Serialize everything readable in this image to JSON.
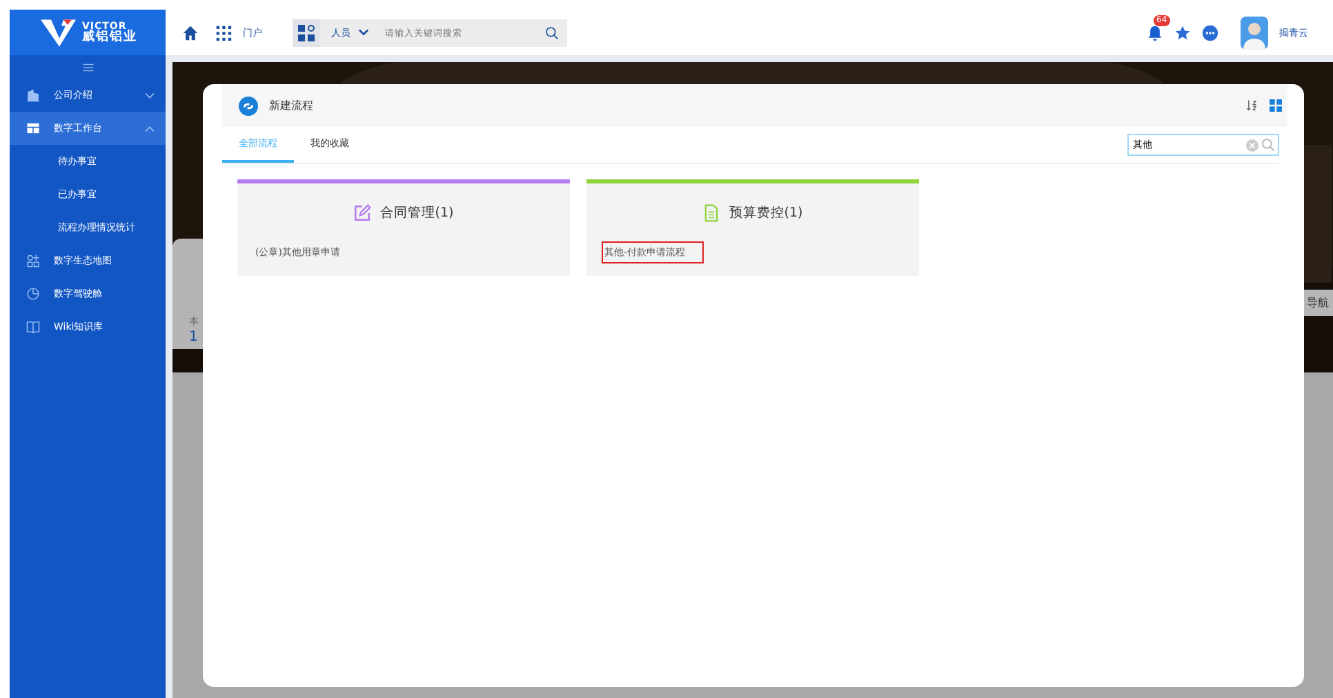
{
  "sidebar": {
    "logo": {
      "wordmark": "VICTOR",
      "name": "威铝铝业"
    },
    "items": [
      {
        "label": "公司介绍",
        "selected": false,
        "expanded": false
      },
      {
        "label": "数字工作台",
        "selected": true,
        "expanded": true,
        "children": [
          {
            "label": "待办事宜"
          },
          {
            "label": "已办事宜"
          },
          {
            "label": "流程办理情况统计"
          }
        ]
      },
      {
        "label": "数字生态地图",
        "selected": false
      },
      {
        "label": "数字驾驶舱",
        "selected": false
      },
      {
        "label": "Wiki知识库",
        "selected": false
      }
    ]
  },
  "header": {
    "portal_label": "门户",
    "search": {
      "scope": "人员",
      "placeholder": "请输入关键词搜索"
    },
    "notifications": {
      "count": "64"
    },
    "user": {
      "name": "揭青云"
    }
  },
  "background": {
    "card_label": "本",
    "card_value": "1",
    "nav_tab": "导航"
  },
  "modal": {
    "title": "新建流程",
    "tabs": [
      {
        "label": "全部流程",
        "selected": true
      },
      {
        "label": "我的收藏",
        "selected": false
      }
    ],
    "search": {
      "value": "其他"
    },
    "groups": [
      {
        "title": "合同管理(1)",
        "color": "#b57cf0",
        "items": [
          {
            "label": "(公章)其他用章申请",
            "highlighted": false
          }
        ]
      },
      {
        "title": "预算费控(1)",
        "color": "#8ed43a",
        "items": [
          {
            "label": "其他-付款申请流程",
            "highlighted": true
          }
        ]
      }
    ]
  }
}
